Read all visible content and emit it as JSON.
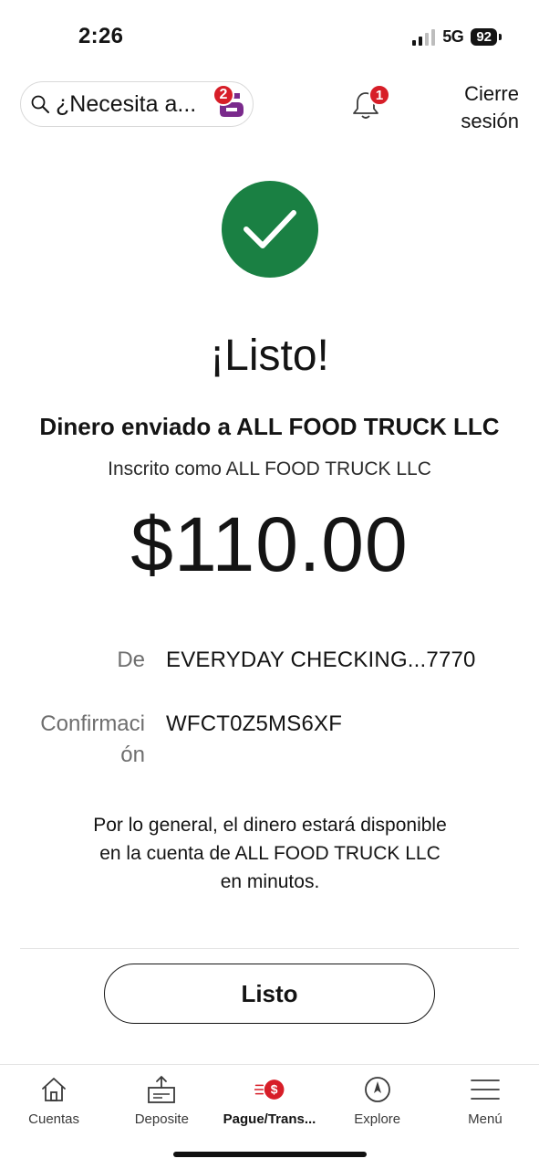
{
  "status_bar": {
    "time": "2:26",
    "network": "5G",
    "battery": "92"
  },
  "header": {
    "search_placeholder": "¿Necesita a...",
    "assistant_badge": "2",
    "notifications_badge": "1",
    "signout_line1": "Cierre",
    "signout_line2": "sesión"
  },
  "confirmation": {
    "title": "¡Listo!",
    "subtitle": "Dinero enviado a ALL FOOD TRUCK LLC",
    "enrolled": "Inscrito como ALL FOOD TRUCK LLC",
    "amount": "$110.00",
    "from_label": "De",
    "from_value": "EVERYDAY CHECKING...7770",
    "conf_label_line1": "Confirmaci",
    "conf_label_line2": "ón",
    "conf_value": "WFCT0Z5MS6XF",
    "note": "Por lo general, el dinero estará disponible en la cuenta de ALL FOOD TRUCK LLC en minutos.",
    "done_button": "Listo"
  },
  "nav": {
    "items": [
      {
        "label": "Cuentas",
        "icon": "home-icon"
      },
      {
        "label": "Deposite",
        "icon": "deposit-icon"
      },
      {
        "label": "Pague/Trans...",
        "icon": "pay-transfer-icon",
        "active": true
      },
      {
        "label": "Explore",
        "icon": "compass-icon"
      },
      {
        "label": "Menú",
        "icon": "menu-icon"
      }
    ]
  },
  "colors": {
    "success": "#1a8043",
    "badge": "#d71e28",
    "assistant": "#7a2a8c"
  }
}
